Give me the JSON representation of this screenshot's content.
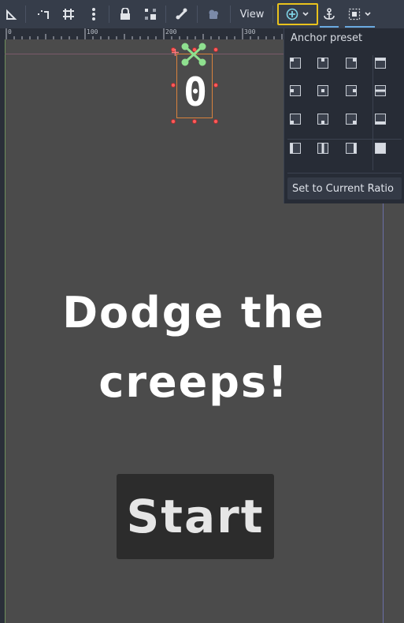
{
  "toolbar": {
    "view_label": "View",
    "icons": [
      "ruler-icon",
      "smart-snap-icon",
      "grid-snap-icon",
      "more-options-icon",
      "lock-icon",
      "group-icon",
      "bone-icon",
      "camera-icon",
      "anchor-preset-icon",
      "anchor-icon",
      "container-sizing-icon"
    ],
    "accent_color": "#e9c21c",
    "active_underline_color": "#6aa9e0"
  },
  "ruler": {
    "labels": [
      "0",
      "100",
      "200",
      "300"
    ]
  },
  "canvas": {
    "score": "0",
    "title": "Dodge the\ncreeps!",
    "start_button": "Start"
  },
  "anchor_popup": {
    "title": "Anchor preset",
    "set_ratio_label": "Set to Current Ratio"
  }
}
